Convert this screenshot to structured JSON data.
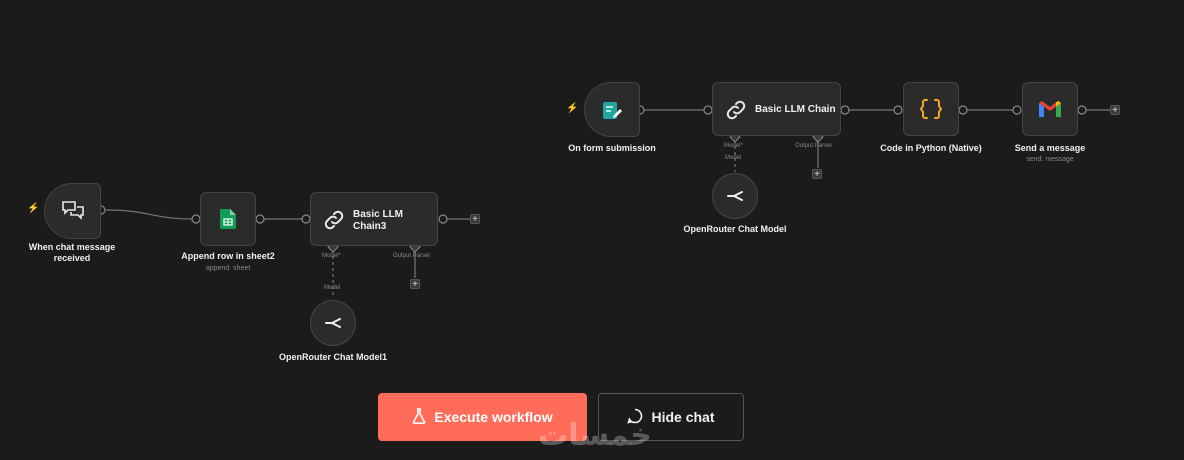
{
  "workflow_a": {
    "trigger_label": "When chat message received",
    "sheet_label": "Append row in sheet2",
    "sheet_sublabel": "append: sheet",
    "chain_title": "Basic LLM Chain3",
    "chain_port_model": "Model",
    "chain_port_parser": "Output Parser",
    "submodel_port": "Model",
    "submodel_label": "OpenRouter Chat Model1"
  },
  "workflow_b": {
    "trigger_label": "On form submission",
    "chain_title": "Basic LLM Chain",
    "chain_port_model": "Model",
    "chain_port_parser": "Output Parser",
    "submodel_port": "Model",
    "submodel_label": "OpenRouter Chat Model",
    "code_label": "Code in Python (Native)",
    "gmail_label": "Send a message",
    "gmail_sublabel": "send: message"
  },
  "buttons": {
    "execute_label": "Execute workflow",
    "hide_chat_label": "Hide chat"
  },
  "required_marker": "*",
  "plus_symbol": "+",
  "watermark": "خمسات",
  "icons": {
    "chat_trigger": "chat-bubbles-icon",
    "sheets": "google-sheets-icon",
    "chain": "link-icon",
    "openrouter": "openrouter-icon",
    "form": "form-icon",
    "code": "curly-braces-icon",
    "gmail": "gmail-icon",
    "execute": "flask-icon",
    "hide_chat": "chat-bubble-icon",
    "bolt": "lightning-icon"
  },
  "colors": {
    "background": "#1b1b1b",
    "node": "#2b2b2b",
    "accent": "#ff6d5a",
    "sheets_green": "#0f9d58",
    "form_teal": "#1fa7a0",
    "code_orange": "#f5a623"
  }
}
